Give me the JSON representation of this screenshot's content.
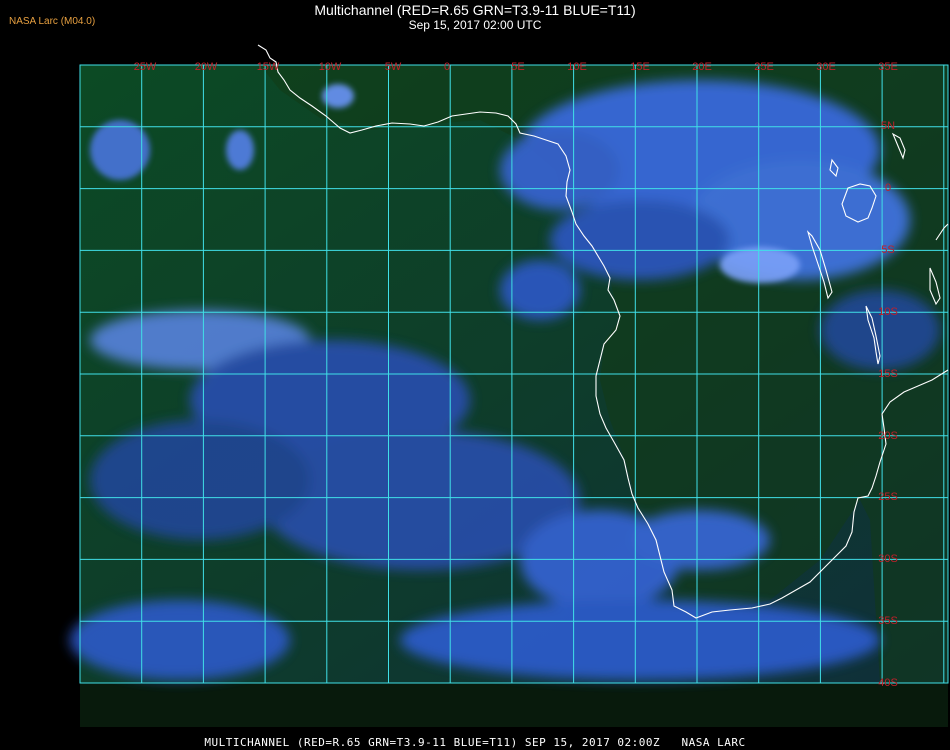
{
  "header": {
    "credit": "NASA Larc (M04.0)",
    "title": "Multichannel (RED=R.65 GRN=T3.9-11 BLUE=T11)",
    "subtitle": "Sep 15, 2017 02:00 UTC"
  },
  "map": {
    "longitude_labels": [
      "25W",
      "20W",
      "15W",
      "10W",
      "5W",
      "0",
      "5E",
      "10E",
      "15E",
      "20E",
      "25E",
      "30E",
      "35E"
    ],
    "latitude_labels": [
      "5N",
      "0",
      "5S",
      "10S",
      "15S",
      "20S",
      "25S",
      "30S",
      "35S",
      "40S"
    ],
    "colors": {
      "grid": "#40e0e8",
      "coast": "#ffffff",
      "labels": "#c0202a",
      "ocean": "#0d3a22",
      "cloud": "#3a66e0"
    }
  },
  "footer": {
    "text": "MULTICHANNEL (RED=R.65 GRN=T3.9-11 BLUE=T11) SEP 15, 2017 02:00Z   NASA LARC"
  }
}
